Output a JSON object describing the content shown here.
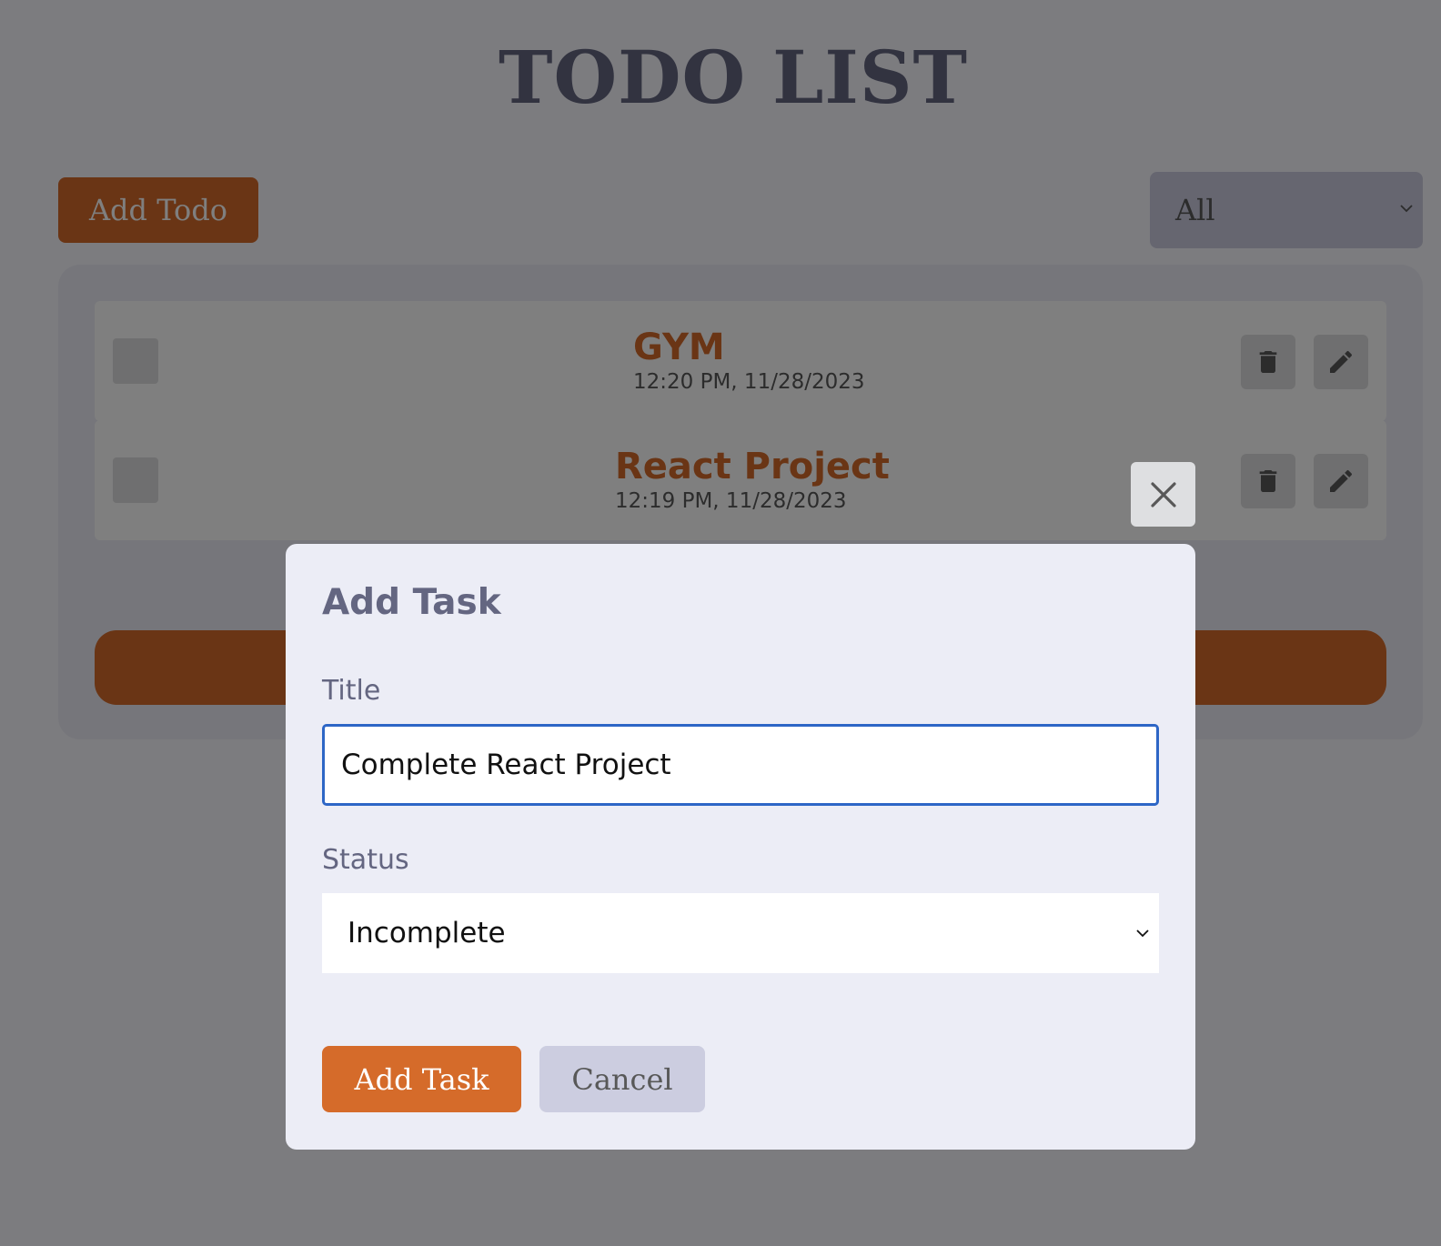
{
  "page": {
    "title": "TODO LIST",
    "add_todo_label": "Add Todo",
    "filter": {
      "selected": "All"
    }
  },
  "todos": [
    {
      "title": "GYM",
      "time": "12:20 PM, 11/28/2023",
      "completed": false
    },
    {
      "title": "React Project",
      "time": "12:19 PM, 11/28/2023",
      "completed": false
    }
  ],
  "icons": {
    "delete": "trash-icon",
    "edit": "pencil-icon",
    "close": "close-icon",
    "dropdown": "chevron-down-icon"
  },
  "modal": {
    "heading": "Add Task",
    "title_label": "Title",
    "title_value": "Complete React Project",
    "status_label": "Status",
    "status_value": "Incomplete",
    "submit_label": "Add Task",
    "cancel_label": "Cancel"
  },
  "colors": {
    "primary": "#d56b2a",
    "secondary": "#cccde0",
    "heading": "#646681",
    "panel": "#ecedf6",
    "focus": "#2d66c6"
  }
}
